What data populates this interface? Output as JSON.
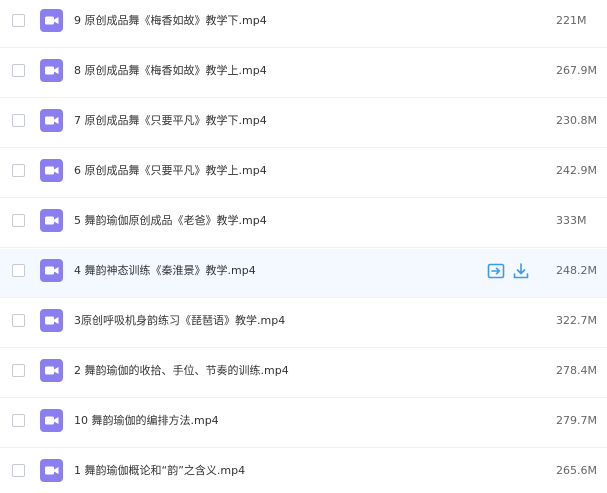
{
  "colors": {
    "icon_bg": "#8b7ef0",
    "action_accent": "#3b9aeb",
    "hover_row_bg": "#f4f8ff"
  },
  "icons": {
    "file": "video-file-icon",
    "share": "share-icon",
    "download": "download-icon"
  },
  "hovered_index": 5,
  "files": [
    {
      "name": "9 原创成品舞《梅香如故》教学下.mp4",
      "size": "221M"
    },
    {
      "name": "8 原创成品舞《梅香如故》教学上.mp4",
      "size": "267.9M"
    },
    {
      "name": "7 原创成品舞《只要平凡》教学下.mp4",
      "size": "230.8M"
    },
    {
      "name": "6 原创成品舞《只要平凡》教学上.mp4",
      "size": "242.9M"
    },
    {
      "name": "5 舞韵瑜伽原创成品《老爸》教学.mp4",
      "size": "333M"
    },
    {
      "name": "4 舞韵神态训练《秦淮景》教学.mp4",
      "size": "248.2M"
    },
    {
      "name": "3原创呼吸机身韵练习《琵琶语》教学.mp4",
      "size": "322.7M"
    },
    {
      "name": "2 舞韵瑜伽的收拾、手位、节奏的训练.mp4",
      "size": "278.4M"
    },
    {
      "name": "10 舞韵瑜伽的编排方法.mp4",
      "size": "279.7M"
    },
    {
      "name": "1 舞韵瑜伽概论和“韵”之含义.mp4",
      "size": "265.6M"
    }
  ]
}
